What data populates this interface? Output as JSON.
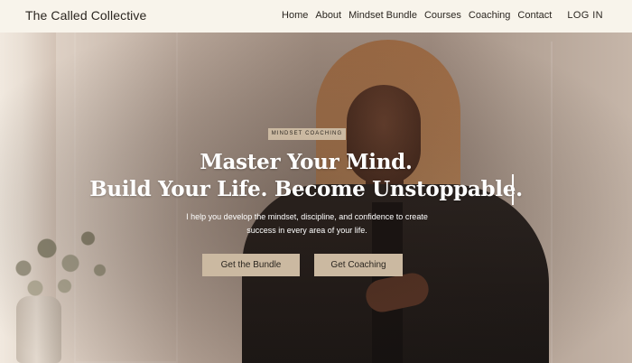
{
  "header": {
    "brand": "The Called Collective",
    "nav": [
      {
        "label": "Home"
      },
      {
        "label": "About"
      },
      {
        "label": "Mindset Bundle"
      },
      {
        "label": "Courses"
      },
      {
        "label": "Coaching"
      },
      {
        "label": "Contact"
      }
    ],
    "login": "LOG IN"
  },
  "hero": {
    "eyebrow": "MINDSET COACHING",
    "headline_line1": "Master Your Mind.",
    "headline_line2": "Build Your Life. Become Unstoppable.",
    "subtext_line1": "I help you develop the mindset, discipline, and confidence to create",
    "subtext_line2": "success in every area of your life.",
    "cta_primary": "Get the Bundle",
    "cta_secondary": "Get Coaching"
  },
  "colors": {
    "header_bg": "#f8f4eb",
    "button_bg": "#cbb9a1",
    "text_dark": "#2b2620",
    "headline": "#ffffff"
  }
}
